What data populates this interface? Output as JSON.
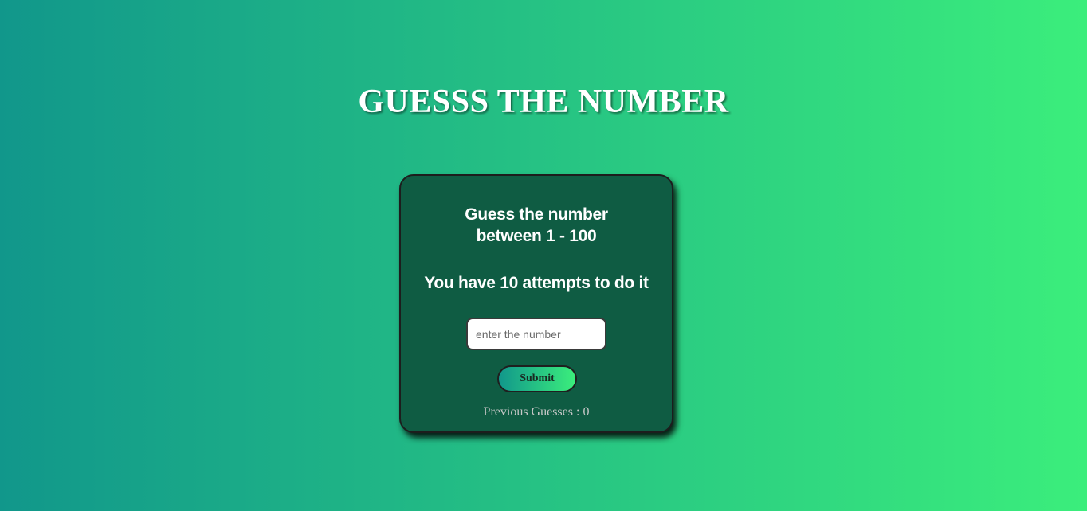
{
  "page": {
    "title": "GUESSS THE NUMBER"
  },
  "card": {
    "prompt_line1": "Guess the number",
    "prompt_line2": "between 1 - 100",
    "attempts_text": "You have 10 attempts to do it",
    "input": {
      "value": "",
      "placeholder": "enter the number"
    },
    "submit_label": "Submit",
    "previous_guesses_label": "Previous Guesses : ",
    "previous_guesses_count": "0"
  },
  "colors": {
    "background_start": "#11978b",
    "background_end": "#3bee7c",
    "card_background": "#0f5c43"
  }
}
